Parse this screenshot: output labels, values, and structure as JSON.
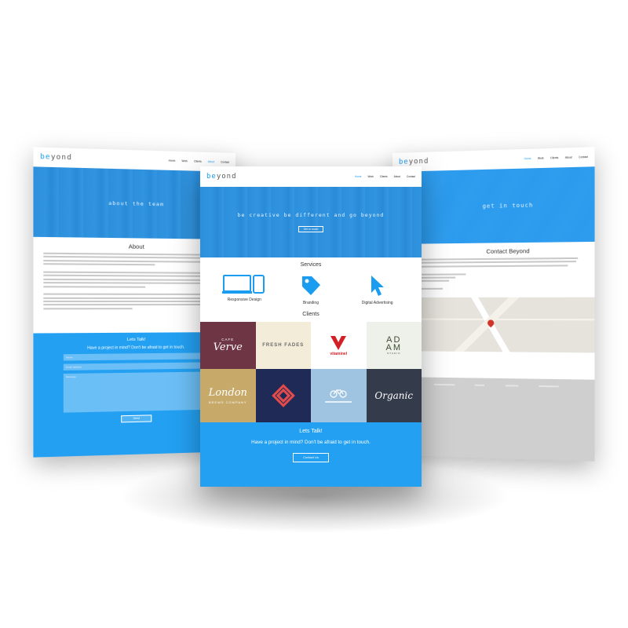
{
  "left_page": {
    "logo": "beyond",
    "nav": [
      "Home",
      "Work",
      "Clients",
      "About",
      "Contact"
    ],
    "hero_title": "about the team",
    "about_heading": "About",
    "cta_heading": "Lets Talk!",
    "cta_text": "Have a project in mind? Don't be afraid to get in touch.",
    "name_placeholder": "Name",
    "email_placeholder": "Email address",
    "message_placeholder": "Message",
    "send_label": "Send"
  },
  "center_page": {
    "logo": "beyond",
    "nav": [
      "Home",
      "Work",
      "Clients",
      "About",
      "Contact"
    ],
    "hero_title": "be creative be different and go beyond",
    "hero_button": "Get in touch",
    "services_heading": "Services",
    "services": [
      {
        "label": "Responsive Design",
        "icon": "devices-icon"
      },
      {
        "label": "Branding",
        "icon": "tag-icon"
      },
      {
        "label": "Digital Advertising",
        "icon": "cursor-icon"
      }
    ],
    "clients_heading": "Clients",
    "clients": [
      {
        "line1": "CAFE",
        "line2": "Verve",
        "bg": "#6e3644",
        "fg": "#ffffff"
      },
      {
        "line1": "Fresh Fades",
        "line2": "",
        "bg": "#f3ecd9",
        "fg": "#6b6b6b"
      },
      {
        "line1": "vitaminel",
        "line2": "",
        "bg": "#ffffff",
        "fg": "#d31f26"
      },
      {
        "line1": "AD",
        "line2": "AM",
        "line3": "STUDIO",
        "bg": "#eef1ea",
        "fg": "#3c4b33"
      },
      {
        "line1": "London",
        "line2": "BREWS COMPANY",
        "bg": "#c7a96a",
        "fg": "#ffffff"
      },
      {
        "line1": "",
        "line2": "",
        "bg": "#1f2a57",
        "fg": "#e64b4b"
      },
      {
        "line1": "",
        "line2": "",
        "bg": "#9fc4e2",
        "fg": "#ffffff"
      },
      {
        "line1": "Organic",
        "line2": "",
        "bg": "#343b4a",
        "fg": "#ffffff"
      }
    ],
    "cta_heading": "Lets Talk!",
    "cta_text": "Have a project in mind? Don't be afraid to get in touch.",
    "cta_button": "Contact Us"
  },
  "right_page": {
    "logo": "beyond",
    "nav": [
      "Home",
      "Work",
      "Clients",
      "About",
      "Contact"
    ],
    "hero_title": "get in touch",
    "contact_heading": "Contact Beyond"
  },
  "colors": {
    "accent": "#1a9df0",
    "cta_blue": "#23a0f2",
    "footer_gray": "#cfcfcf"
  }
}
